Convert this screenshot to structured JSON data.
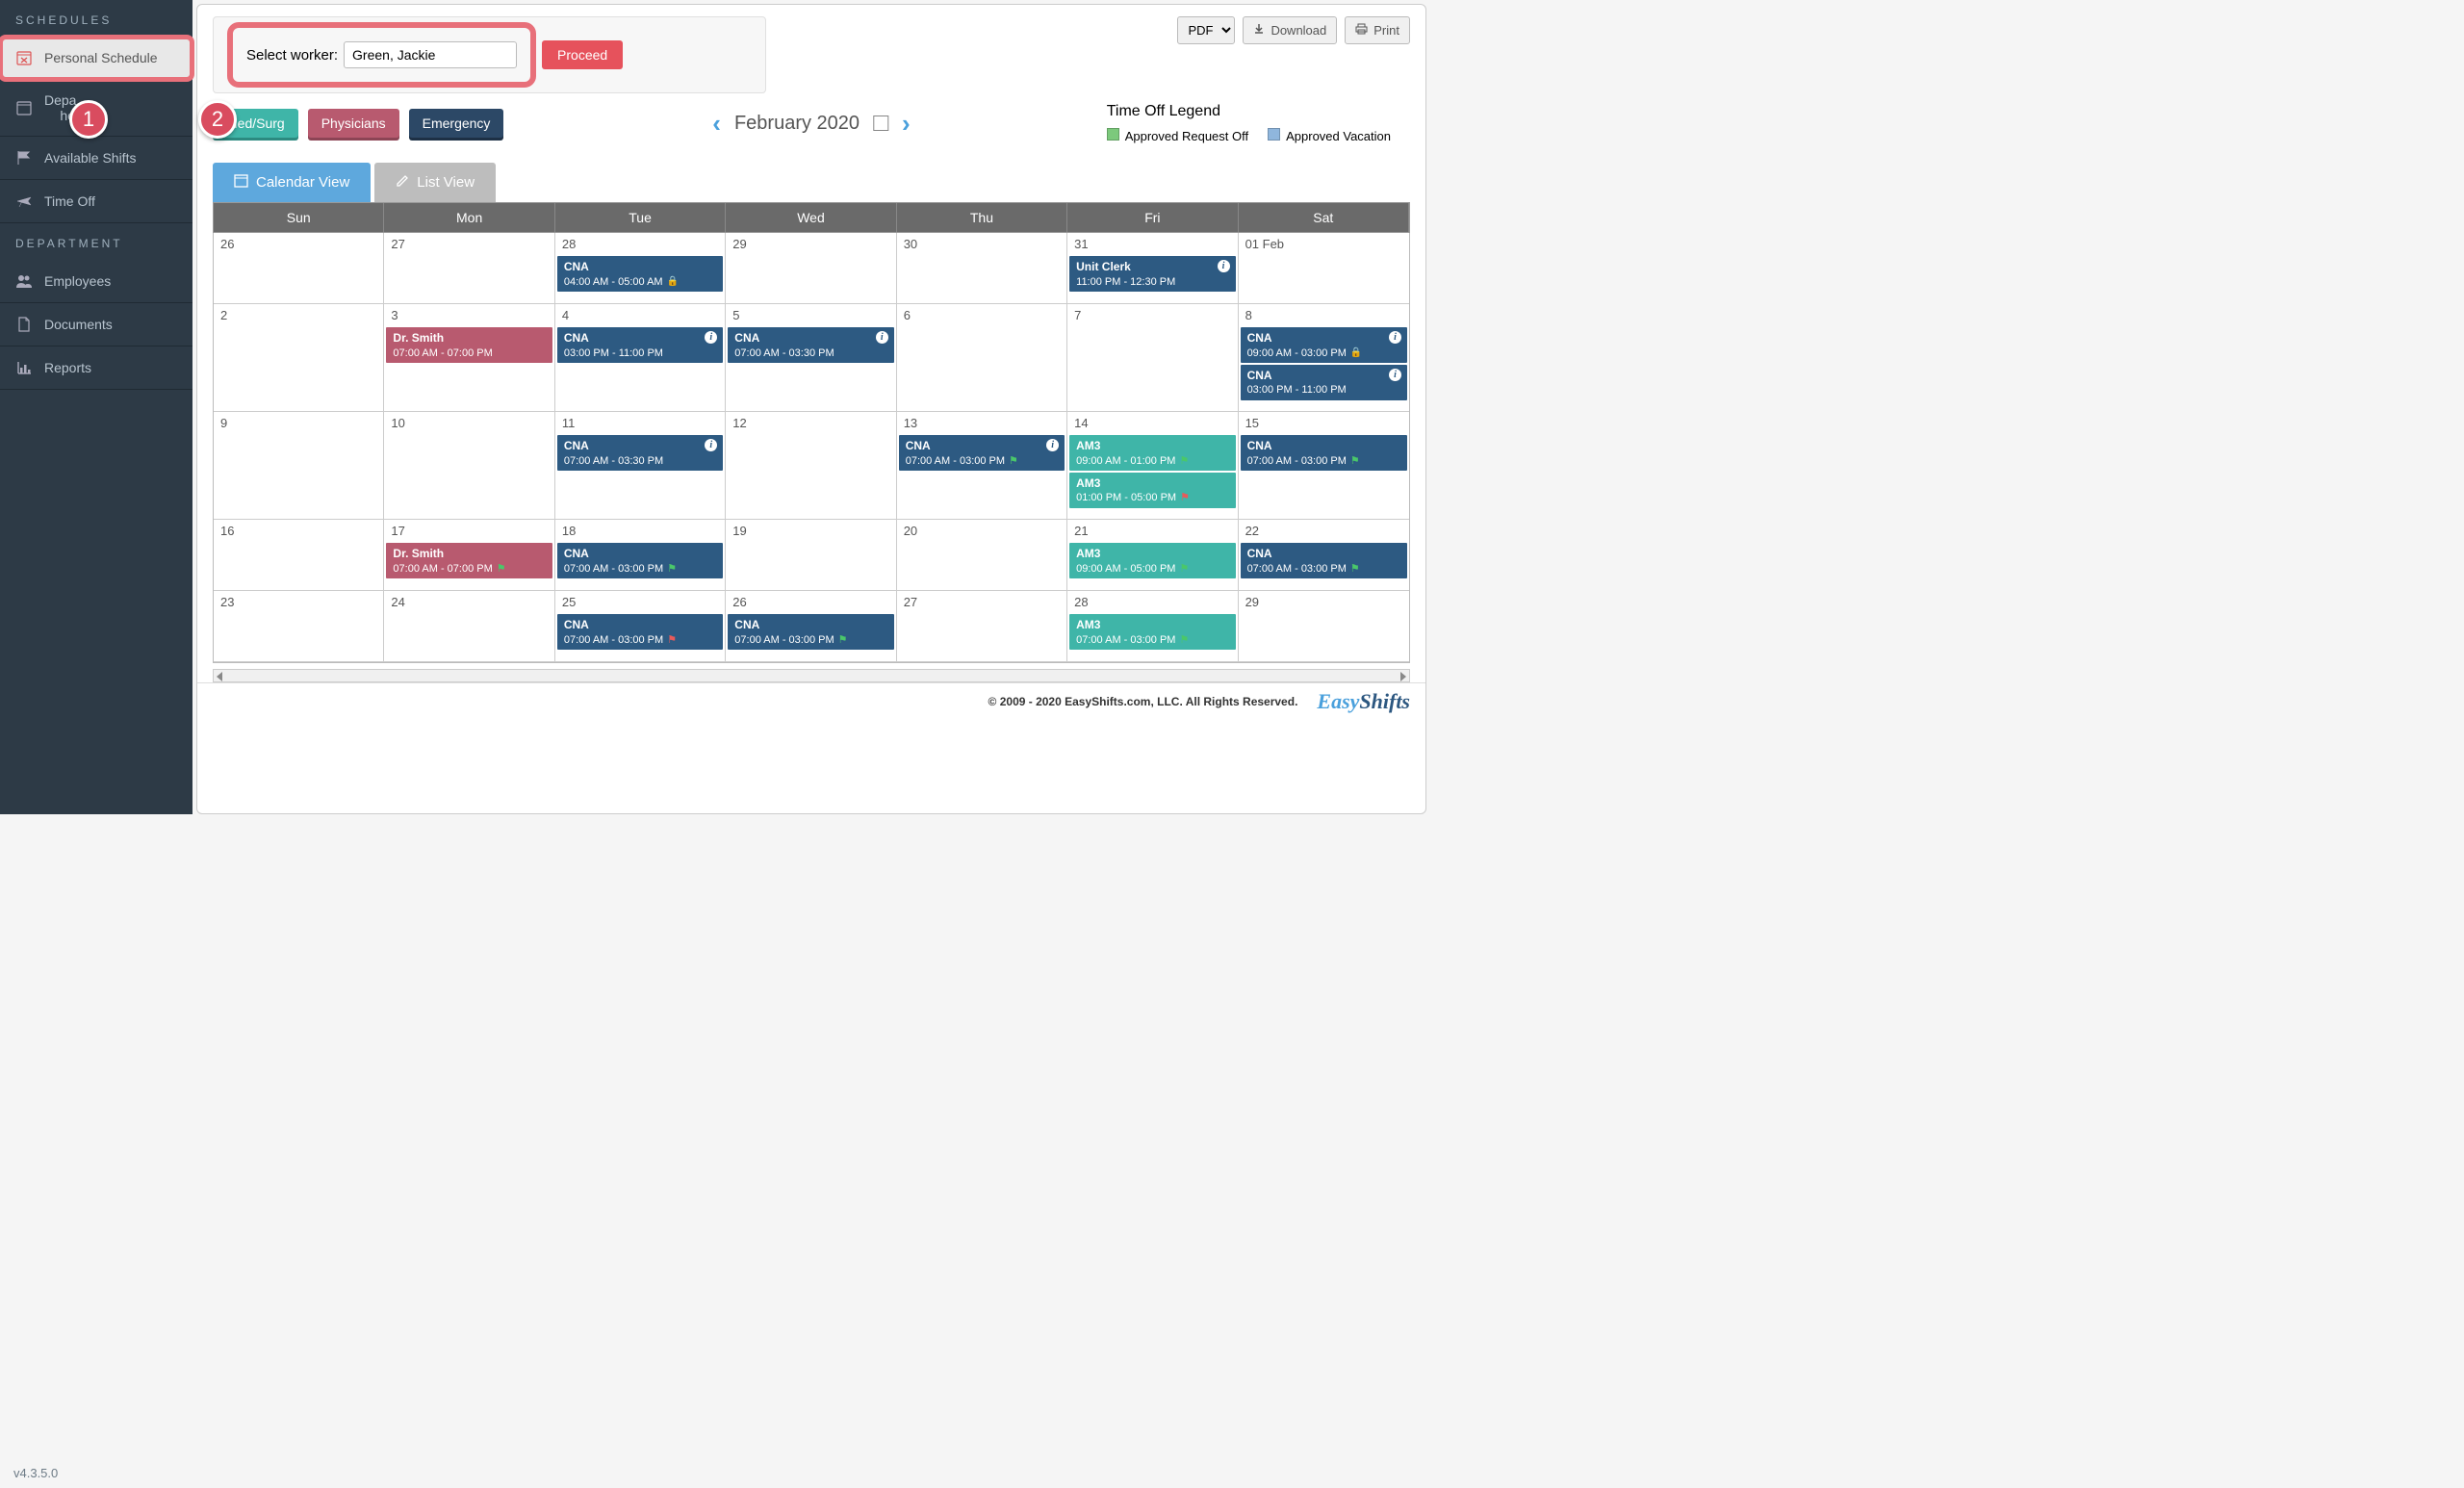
{
  "sidebar": {
    "section1": "SCHEDULES",
    "section2": "DEPARTMENT",
    "items": [
      {
        "label": "Personal Schedule"
      },
      {
        "label": "Department Schedules"
      },
      {
        "label": "Available Shifts"
      },
      {
        "label": "Time Off"
      },
      {
        "label": "Employees"
      },
      {
        "label": "Documents"
      },
      {
        "label": "Reports"
      }
    ]
  },
  "worker": {
    "label": "Select worker:",
    "value": "Green, Jackie",
    "proceed": "Proceed"
  },
  "top": {
    "pdf": "PDF",
    "download": "Download",
    "print": "Print"
  },
  "tags": {
    "med": "Med/Surg",
    "phys": "Physicians",
    "emerg": "Emergency"
  },
  "month": "February 2020",
  "legend": {
    "title": "Time Off Legend",
    "approved_off": "Approved Request Off",
    "approved_vac": "Approved Vacation"
  },
  "views": {
    "calendar": "Calendar View",
    "list": "List View"
  },
  "days": [
    "Sun",
    "Mon",
    "Tue",
    "Wed",
    "Thu",
    "Fri",
    "Sat"
  ],
  "cells": {
    "r0": [
      "26",
      "27",
      "28",
      "29",
      "30",
      "31",
      "01 Feb"
    ],
    "r1": [
      "2",
      "3",
      "4",
      "5",
      "6",
      "7",
      "8"
    ],
    "r2": [
      "9",
      "10",
      "11",
      "12",
      "13",
      "14",
      "15"
    ],
    "r3": [
      "16",
      "17",
      "18",
      "19",
      "20",
      "21",
      "22"
    ],
    "r4": [
      "23",
      "24",
      "25",
      "26",
      "27",
      "28",
      "29"
    ]
  },
  "shifts": {
    "cna": "CNA",
    "unitclerk": "Unit Clerk",
    "drsmith": "Dr. Smith",
    "am3": "AM3",
    "t_0400_0500": "04:00 AM - 05:00 AM",
    "t_1100_1230": "11:00 PM - 12:30 PM",
    "t_0700_1900": "07:00 AM - 07:00 PM",
    "t_1500_2300": "03:00 PM - 11:00 PM",
    "t_0700_0330": "07:00 AM - 03:30 PM",
    "t_0900_1500": "09:00 AM - 03:00 PM",
    "t_0700_1500": "07:00 AM - 03:00 PM",
    "t_0900_1300": "09:00 AM - 01:00 PM",
    "t_1300_1700": "01:00 PM - 05:00 PM",
    "t_0900_1700": "09:00 AM - 05:00 PM"
  },
  "annotations": {
    "a1": "1",
    "a2": "2"
  },
  "footer": {
    "version": "v4.3.5.0",
    "copyright": "© 2009 - 2020 EasyShifts.com, LLC. All Rights Reserved.",
    "logo1": "Easy",
    "logo2": "Shifts"
  }
}
